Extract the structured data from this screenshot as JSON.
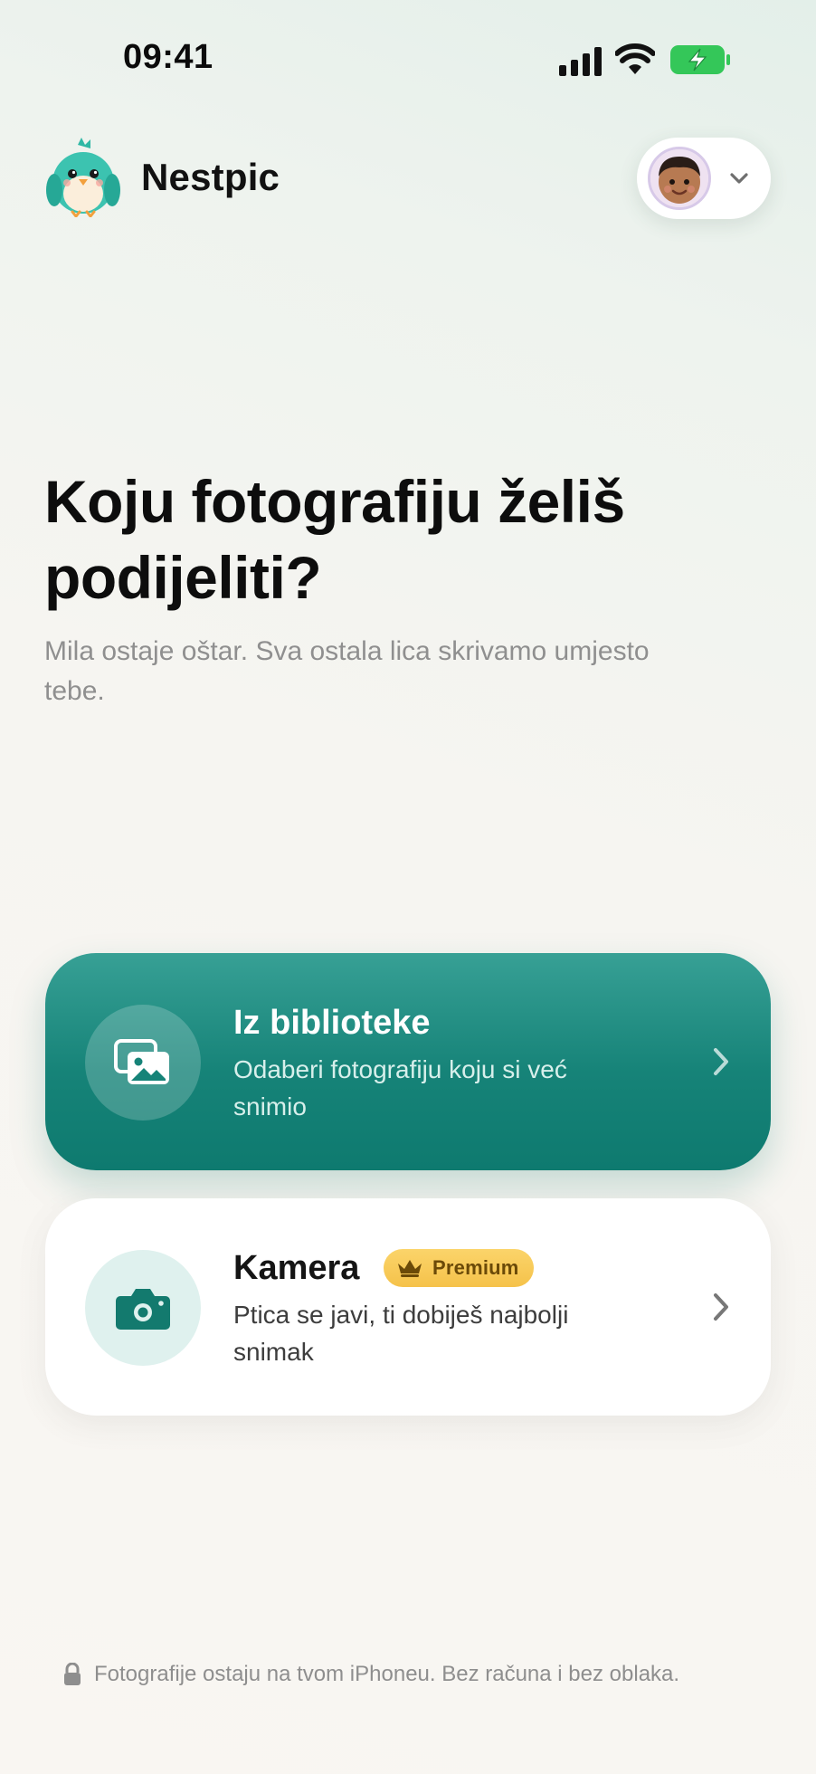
{
  "status_bar": {
    "time": "09:41",
    "signal_icon": "cellular-signal-icon",
    "wifi_icon": "wifi-icon",
    "battery_icon": "battery-charging-icon",
    "battery_color": "#34c759"
  },
  "header": {
    "app_name": "Nestpic",
    "logo_icon": "bird-mascot-icon",
    "profile": {
      "avatar_icon": "child-avatar-icon",
      "chevron_icon": "chevron-down-icon"
    }
  },
  "hero": {
    "title": "Koju fotografiju želiš podijeliti?",
    "subtitle": "Mila ostaje oštar. Sva ostala lica skrivamo umjesto tebe."
  },
  "options": {
    "library": {
      "title": "Iz biblioteke",
      "description": "Odaberi fotografiju koju si već snimio",
      "icon": "photo-library-icon",
      "accent": "#147f74"
    },
    "camera": {
      "title": "Kamera",
      "badge": "Premium",
      "badge_icon": "crown-icon",
      "description": "Ptica se javi, ti dobiješ najbolji snimak",
      "icon": "camera-icon",
      "accent": "#137a6e"
    }
  },
  "footer": {
    "note": "Fotografije ostaju na tvom iPhoneu. Bez računa i bez oblaka.",
    "icon": "lock-icon"
  }
}
